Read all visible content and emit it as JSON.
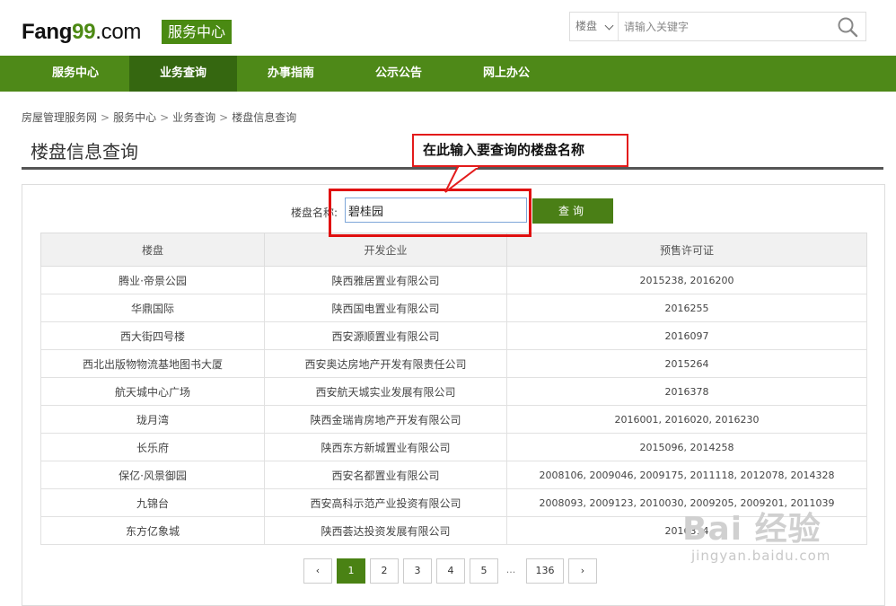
{
  "header": {
    "logo": {
      "prefix": "Fang",
      "num": "99",
      "suffix": ".com"
    },
    "badge": "服务中心",
    "search": {
      "category": "楼盘",
      "placeholder": "请输入关键字"
    }
  },
  "nav": {
    "items": [
      {
        "label": "服务中心",
        "active": false
      },
      {
        "label": "业务查询",
        "active": true
      },
      {
        "label": "办事指南",
        "active": false
      },
      {
        "label": "公示公告",
        "active": false
      },
      {
        "label": "网上办公",
        "active": false
      }
    ]
  },
  "breadcrumb": {
    "items": [
      "房屋管理服务网",
      "服务中心",
      "业务查询",
      "楼盘信息查询"
    ],
    "separator": ">"
  },
  "page_title": "楼盘信息查询",
  "form": {
    "label": "楼盘名称:",
    "value": "碧桂园",
    "button": "查询"
  },
  "table": {
    "headers": [
      "楼盘",
      "开发企业",
      "预售许可证"
    ],
    "rows": [
      [
        "腾业·帝景公园",
        "陕西雅居置业有限公司",
        "2015238, 2016200"
      ],
      [
        "华鼎国际",
        "陕西国电置业有限公司",
        "2016255"
      ],
      [
        "西大街四号楼",
        "西安源顺置业有限公司",
        "2016097"
      ],
      [
        "西北出版物物流基地图书大厦",
        "西安奥达房地产开发有限责任公司",
        "2015264"
      ],
      [
        "航天城中心广场",
        "西安航天城实业发展有限公司",
        "2016378"
      ],
      [
        "珑月湾",
        "陕西金瑞肯房地产开发有限公司",
        "2016001, 2016020, 2016230"
      ],
      [
        "长乐府",
        "陕西东方新城置业有限公司",
        "2015096, 2014258"
      ],
      [
        "保亿·风景御园",
        "西安名都置业有限公司",
        "2008106, 2009046, 2009175, 2011118, 2012078, 2014328"
      ],
      [
        "九锦台",
        "西安高科示范产业投资有限公司",
        "2008093, 2009123, 2010030, 2009205, 2009201, 2011039"
      ],
      [
        "东方亿象城",
        "陕西荟达投资发展有限公司",
        "2016314"
      ]
    ]
  },
  "pagination": {
    "prev": "‹",
    "pages": [
      "1",
      "2",
      "3",
      "4",
      "5"
    ],
    "current": "1",
    "ellipsis": "...",
    "last": "136",
    "next": "›"
  },
  "annotation": {
    "text": "在此输入要查询的楼盘名称"
  },
  "watermark": {
    "main": "Bai 经验",
    "sub": "jingyan.baidu.com"
  },
  "colors": {
    "nav_bg": "#4e8918",
    "nav_active": "#356710",
    "brand_green": "#4a8a12",
    "annotation_red": "#e31b1b"
  }
}
